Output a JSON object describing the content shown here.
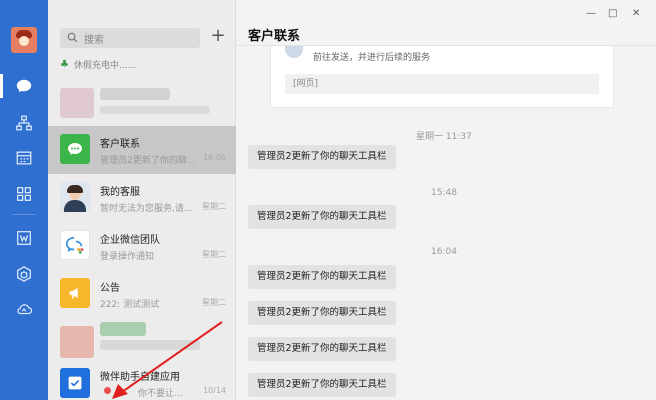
{
  "window": {
    "title": "客户联系",
    "controls": [
      "—",
      "□",
      "✕"
    ]
  },
  "rail": {
    "icons": [
      "chat-icon",
      "org-icon",
      "calendar-icon",
      "apps-icon",
      "doc-icon",
      "box-icon",
      "cloud-icon"
    ]
  },
  "list": {
    "search_placeholder": "搜索",
    "add_label": "+",
    "status_text": "休假充电中......",
    "items": [
      {
        "name": "客户联系",
        "preview": "管理员2更新了你的聊...",
        "time": "16:05"
      },
      {
        "name": "我的客服",
        "preview": "暂时无法为您服务,请...",
        "time": "星期二"
      },
      {
        "name": "企业微信团队",
        "preview": "登录操作通知",
        "time": "星期二"
      },
      {
        "name": "公告",
        "preview": "222: 测试测试",
        "time": "星期二"
      },
      {
        "name": "微伴助手自建应用",
        "preview": "你不要让...",
        "time": "10/14"
      }
    ]
  },
  "chat": {
    "card_text": "前往发送，并进行后续的服务",
    "card_footer": "[网页]",
    "messages": [
      {
        "time": "星期一 11:37",
        "text": "管理员2更新了你的聊天工具栏"
      },
      {
        "time": "15:48",
        "text": "管理员2更新了你的聊天工具栏"
      },
      {
        "time": "16:04",
        "text": "管理员2更新了你的聊天工具栏"
      },
      {
        "time": "",
        "text": "管理员2更新了你的聊天工具栏"
      },
      {
        "time": "",
        "text": "管理员2更新了你的聊天工具栏"
      },
      {
        "time": "",
        "text": "管理员2更新了你的聊天工具栏"
      }
    ]
  },
  "colors": {
    "rail": "#2f6fcf",
    "list_bg": "#ececec",
    "selected": "#c7c7c7",
    "chat_bg": "#f3f3f3",
    "bubble": "#e2e2e2",
    "annotation": "#e02020"
  }
}
